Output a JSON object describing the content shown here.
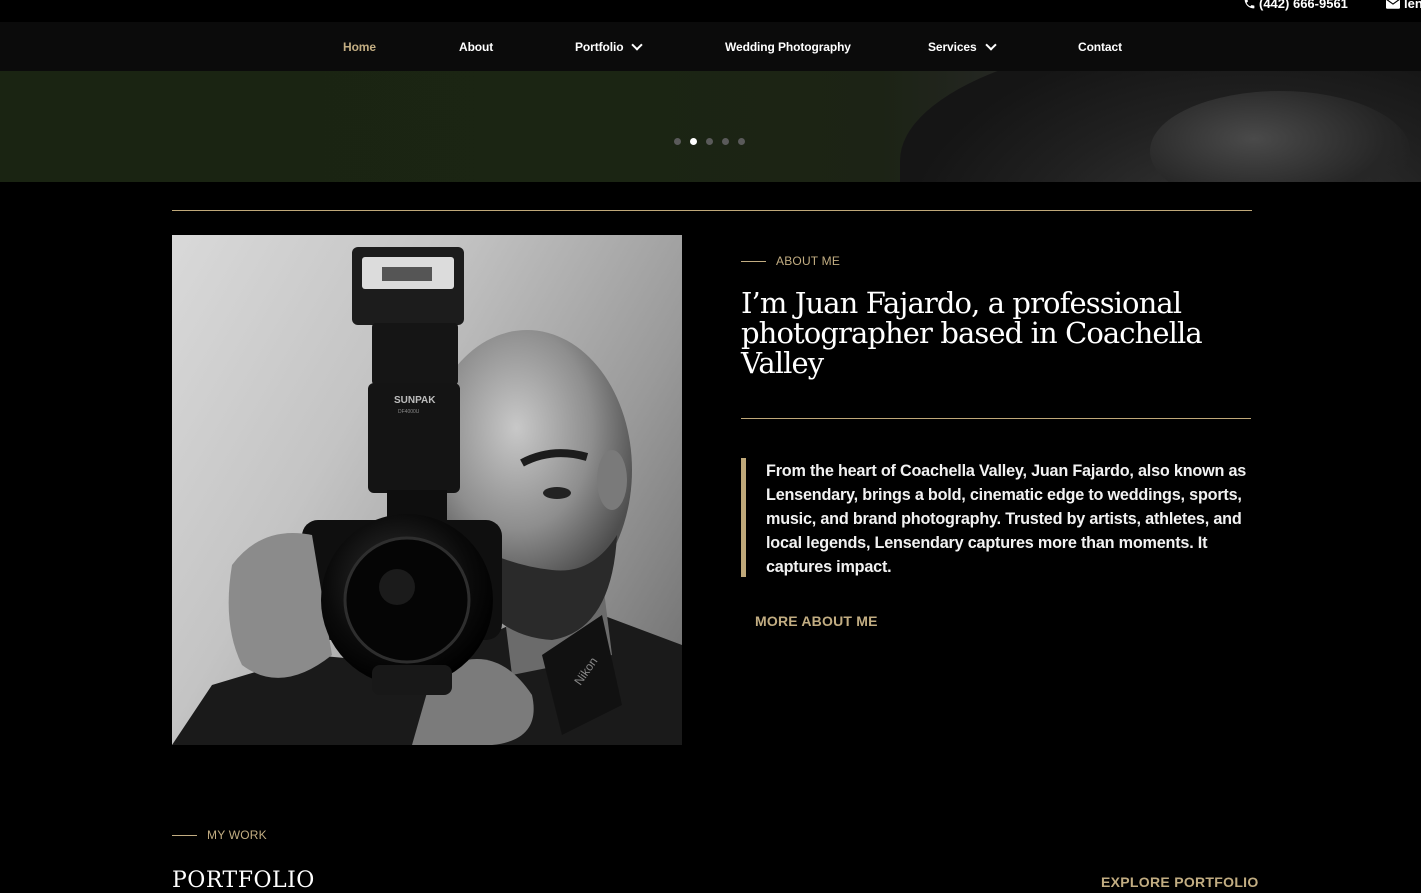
{
  "topbar": {
    "phone": "(442) 666-9561",
    "email_partial": "len"
  },
  "nav": {
    "items": [
      {
        "label": "Home",
        "active": true
      },
      {
        "label": "About"
      },
      {
        "label": "Portfolio",
        "dropdown": true
      },
      {
        "label": "Wedding Photography"
      },
      {
        "label": "Services",
        "dropdown": true
      },
      {
        "label": "Contact"
      }
    ]
  },
  "hero": {
    "slide_count": 5,
    "active_slide": 2
  },
  "about": {
    "kicker": "ABOUT ME",
    "headline": "I’m Juan Fajardo, a professional photographer based in Coachella Valley",
    "quote": "From the heart of Coachella Valley, Juan Fajardo, also known as Lensendary, brings a bold, cinematic edge to weddings, sports, music, and brand photography. Trusted by artists, athletes, and local legends, Lensendary captures more than moments. It captures impact.",
    "more_link": "MORE ABOUT ME",
    "portrait_flash_brand": "SUNPAK",
    "portrait_flash_model": "DF4000U",
    "portrait_strap_brand": "Nikon"
  },
  "work": {
    "kicker": "MY WORK",
    "title": "PORTFOLIO",
    "explore_link": "EXPLORE PORTFOLIO"
  },
  "colors": {
    "accent": "#c2ad82",
    "background": "#000000",
    "nav_bg": "#0b0b0b"
  }
}
